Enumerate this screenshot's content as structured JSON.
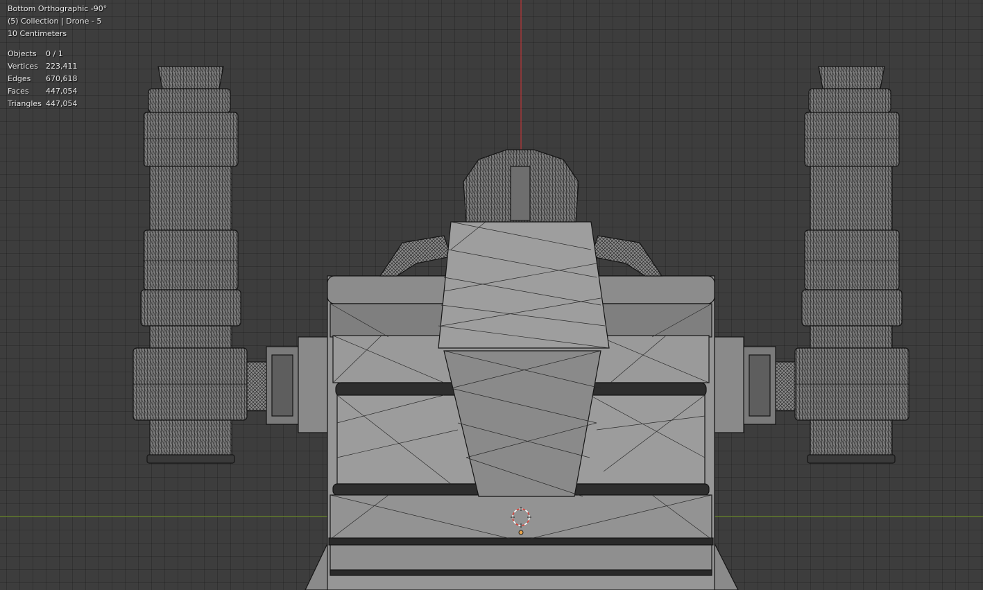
{
  "viewport": {
    "view_name": "Bottom Orthographic -90°",
    "collection": "(5) Collection | Drone - 5",
    "scale": "10 Centimeters",
    "stats": [
      {
        "label": "Objects",
        "value": "0 / 1"
      },
      {
        "label": "Vertices",
        "value": "223,411"
      },
      {
        "label": "Edges",
        "value": "670,618"
      },
      {
        "label": "Faces",
        "value": "447,054"
      },
      {
        "label": "Triangles",
        "value": "447,054"
      }
    ]
  },
  "colors": {
    "background": "#3d3d3d",
    "z_axis": "#c0393b",
    "x_axis": "#6c8a2c",
    "mesh_fill": "#8e8e8e",
    "wire": "#1c1c1c"
  }
}
